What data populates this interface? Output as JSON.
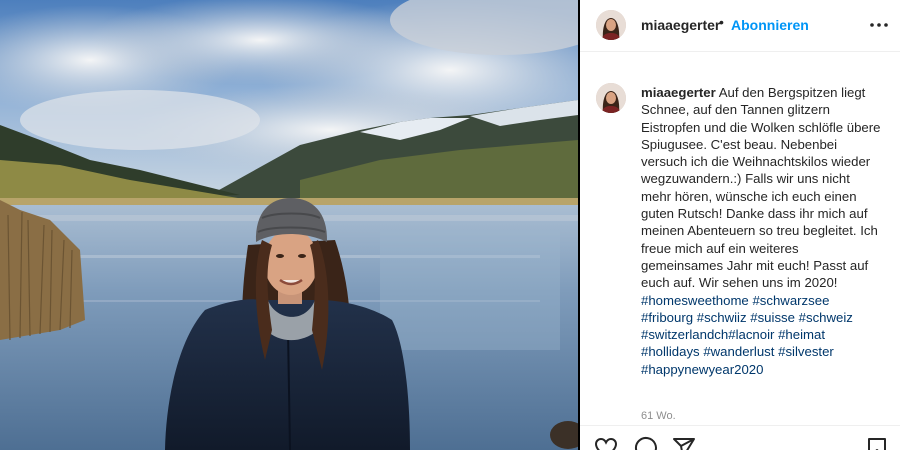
{
  "post": {
    "username": "miaaegerter",
    "separator": "•",
    "follow_label": "Abonnieren",
    "caption": "Auf den Bergspitzen liegt Schnee, auf den Tannen glitzern Eistropfen und die Wolken schlöfle übere Spiugusee. C'est beau. Nebenbei versuch ich die Weihnachtskilos wieder wegzuwandern.:) Falls wir uns nicht mehr hören, wünsche ich euch einen guten Rutsch! Danke dass ihr mich auf meinen Abenteuern so treu begleitet. Ich freue mich auf ein weiteres gemeinsames Jahr mit euch! Passt auf euch auf. Wir sehen uns im 2020!",
    "hashtags": [
      "#homesweethome",
      "#schwarzsee",
      "#fribourg",
      "#schwiiz",
      "#suisse",
      "#schweiz",
      "#switzerlandch",
      "#lacnoir",
      "#heimat",
      "#hollidays",
      "#wanderlust",
      "#silvester",
      "#happynewyear2020"
    ],
    "timestamp": "61 Wo."
  },
  "icons": {
    "more": "more-options-icon",
    "like": "heart-icon",
    "comment": "comment-icon",
    "share": "share-icon",
    "save": "bookmark-icon"
  },
  "colors": {
    "link_blue": "#0095f6",
    "hashtag_blue": "#00376b",
    "text": "#262626",
    "muted": "#8e8e8e"
  }
}
